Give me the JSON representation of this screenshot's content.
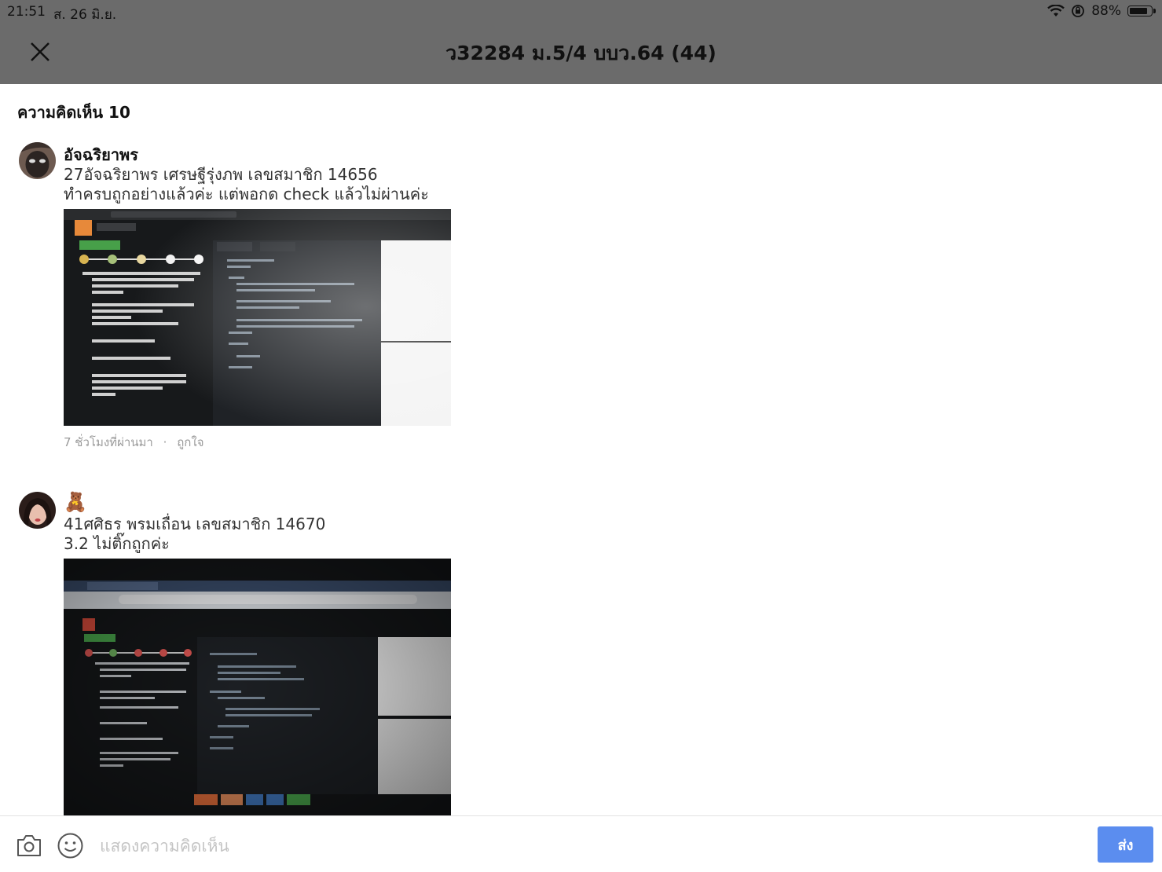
{
  "status_bar": {
    "time": "21:51",
    "date": "ส. 26 มิ.ย.",
    "battery": "88%",
    "battery_level": 0.88,
    "icons": [
      "wifi-icon",
      "orientation-lock-icon",
      "battery-icon"
    ]
  },
  "header": {
    "title": "ว32284 ม.5/4 บบว.64 (44)",
    "close_icon": "close-icon"
  },
  "comments_section": {
    "count_label": "ความคิดเห็น 10",
    "comments": [
      {
        "author": "อัจฉริยาพร",
        "text": "27อัจฉริยาพร เศรษฐีรุ่งภพ เลขสมาชิก 14656\nทำครบถูกอย่างแล้วค่ะ แต่พอกด check แล้วไม่ผ่านค่ะ",
        "time": "7 ชั่วโมงที่ผ่านมา",
        "separator": "·",
        "like_label": "ถูกใจ"
      },
      {
        "author": "🧸",
        "text": "41ศศิธร พรมเถื่อน เลขสมาชิก 14670\n3.2 ไม่ติ๊กถูกค่ะ"
      }
    ]
  },
  "composer": {
    "placeholder": "แสดงความคิดเห็น",
    "value": "",
    "send_label": "ส่ง",
    "camera_icon": "camera-icon",
    "emoji_icon": "emoji-icon"
  },
  "colors": {
    "header_bg": "#6b6b6b",
    "send_button": "#5b8def",
    "meta_text": "#9a9a9a"
  }
}
